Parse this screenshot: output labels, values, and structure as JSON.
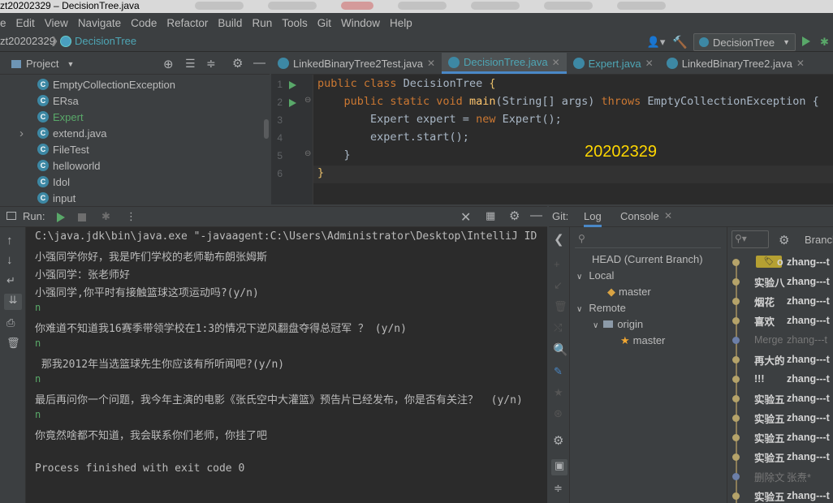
{
  "window": {
    "title": "zt20202329 – DecisionTree.java"
  },
  "menu": [
    "e",
    "Edit",
    "View",
    "Navigate",
    "Code",
    "Refactor",
    "Build",
    "Run",
    "Tools",
    "Git",
    "Window",
    "Help"
  ],
  "breadcrumb": {
    "project": "zt20202329",
    "file": "DecisionTree"
  },
  "run_config": {
    "selected": "DecisionTree"
  },
  "project_panel": {
    "title": "Project",
    "items": [
      {
        "label": "EmptyCollectionException",
        "kind": "class",
        "expandable": false
      },
      {
        "label": "ERsa",
        "kind": "class",
        "expandable": false
      },
      {
        "label": "Expert",
        "kind": "class",
        "expandable": false,
        "highlight": true
      },
      {
        "label": "extend.java",
        "kind": "class",
        "expandable": true
      },
      {
        "label": "FileTest",
        "kind": "class",
        "expandable": false
      },
      {
        "label": "helloworld",
        "kind": "class",
        "expandable": false
      },
      {
        "label": "Idol",
        "kind": "class",
        "expandable": false
      },
      {
        "label": "input",
        "kind": "class",
        "expandable": false
      }
    ]
  },
  "tabs": [
    {
      "label": "LinkedBinaryTree2Test.java",
      "active": false
    },
    {
      "label": "DecisionTree.java",
      "active": true
    },
    {
      "label": "Expert.java",
      "active": false
    },
    {
      "label": "LinkedBinaryTree2.java",
      "active": false
    }
  ],
  "editor": {
    "line_numbers": [
      "1",
      "2",
      "3",
      "4",
      "5",
      "6"
    ],
    "lines": [
      {
        "kw": "public class ",
        "rest": "DecisionTree ",
        "brace": "{"
      },
      {
        "kw": "    public static void ",
        "fn": "main",
        "rest": "(String[] args) ",
        "kw2": "throws ",
        "rest2": "EmptyCollectionException {"
      },
      {
        "rest": "        Expert expert = ",
        "kw": "new ",
        "rest2": "Expert();"
      },
      {
        "rest": "        expert.start();"
      },
      {
        "rest": "    }"
      },
      {
        "brace": "}"
      }
    ],
    "watermark": "20202329"
  },
  "run_panel": {
    "label": "Run:",
    "console": [
      {
        "text": "C:\\java.jdk\\bin\\java.exe \"-javaagent:C:\\Users\\Administrator\\Desktop\\IntelliJ ID",
        "type": "norm"
      },
      {
        "text": "小强同学你好，我是咋们学校的老师勒布朗张姆斯",
        "type": "norm"
      },
      {
        "text": "小强同学：张老师好",
        "type": "norm"
      },
      {
        "text": "小强同学,你平时有接触篮球这项运动吗?(y/n)",
        "type": "norm"
      },
      {
        "text": "n",
        "type": "inp"
      },
      {
        "text": "你难道不知道我16赛季带领学校在1:3的情况下逆风翻盘夺得总冠军 ？ (y/n)",
        "type": "norm"
      },
      {
        "text": "n",
        "type": "inp"
      },
      {
        "text": " 那我2012年当选篮球先生你应该有所听闻吧?(y/n)",
        "type": "norm"
      },
      {
        "text": "n",
        "type": "inp"
      },
      {
        "text": "最后再问你一个问题，我今年主演的电影《张氏空中大灌篮》预告片已经发布，你是否有关注？  (y/n)",
        "type": "norm"
      },
      {
        "text": "n",
        "type": "inp"
      },
      {
        "text": "你竟然啥都不知道，我会联系你们老师，你挂了吧",
        "type": "norm"
      },
      {
        "text": "",
        "type": "norm"
      },
      {
        "text": "Process finished with exit code 0",
        "type": "norm"
      }
    ]
  },
  "git_panel": {
    "label": "Git:",
    "tabs": [
      "Log",
      "Console"
    ],
    "branch_filter": "Branch",
    "branches": {
      "head": "HEAD (Current Branch)",
      "local": "Local",
      "local_master": "master",
      "remote": "Remote",
      "origin": "origin",
      "origin_master": "master"
    },
    "log": [
      {
        "msg": "o",
        "author": "zhang---t",
        "dim": false,
        "tag": true
      },
      {
        "msg": "实验八",
        "author": "zhang---t",
        "dim": false
      },
      {
        "msg": "烟花",
        "author": "zhang---t",
        "dim": false
      },
      {
        "msg": "喜欢",
        "author": "zhang---t",
        "dim": false
      },
      {
        "msg": "Merge",
        "author": "zhang---t",
        "dim": true
      },
      {
        "msg": "再大的",
        "author": "zhang---t",
        "dim": false
      },
      {
        "msg": "!!!",
        "author": "zhang---t",
        "dim": false
      },
      {
        "msg": "实验五",
        "author": "zhang---t",
        "dim": false
      },
      {
        "msg": "实验五",
        "author": "zhang---t",
        "dim": false
      },
      {
        "msg": "实验五",
        "author": "zhang---t",
        "dim": false
      },
      {
        "msg": "实验五",
        "author": "zhang---t",
        "dim": false
      },
      {
        "msg": "删除文",
        "author": "张焘*",
        "dim": true
      },
      {
        "msg": "实验五",
        "author": "zhang---t",
        "dim": false
      }
    ]
  },
  "colors": {
    "accent": "#4a88c7",
    "green": "#59a869",
    "cyan": "#4ea6b5",
    "keyword": "#cc7832",
    "watermark": "#ffd700"
  }
}
